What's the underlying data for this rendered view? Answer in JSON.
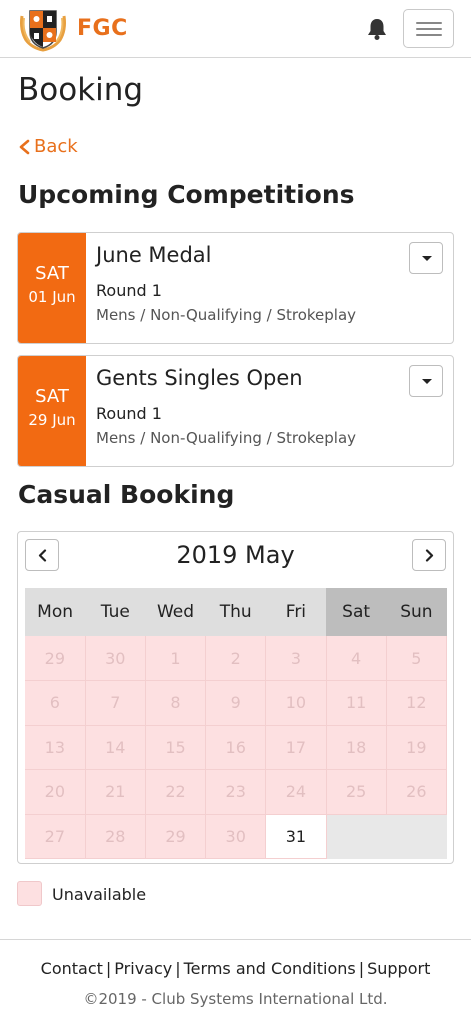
{
  "header": {
    "brand": "FGC",
    "icons": {
      "logo": "club-crest-logo",
      "notifications": "bell-icon",
      "menu": "hamburger-menu-icon"
    },
    "accent_color": "#e8701c"
  },
  "page": {
    "title": "Booking",
    "back_label": "Back"
  },
  "upcoming": {
    "title": "Upcoming Competitions",
    "items": [
      {
        "day": "SAT",
        "date": "01 Jun",
        "name": "June Medal",
        "round": "Round 1",
        "type": "Mens / Non-Qualifying / Strokeplay"
      },
      {
        "day": "SAT",
        "date": "29 Jun",
        "name": "Gents Singles Open",
        "round": "Round 1",
        "type": "Mens / Non-Qualifying / Strokeplay"
      }
    ]
  },
  "casual": {
    "title": "Casual Booking",
    "calendar": {
      "title": "2019 May",
      "weekdays": [
        "Mon",
        "Tue",
        "Wed",
        "Thu",
        "Fri",
        "Sat",
        "Sun"
      ],
      "weeks": [
        [
          {
            "d": "29",
            "s": "unavailable"
          },
          {
            "d": "30",
            "s": "unavailable"
          },
          {
            "d": "1",
            "s": "unavailable"
          },
          {
            "d": "2",
            "s": "unavailable"
          },
          {
            "d": "3",
            "s": "unavailable"
          },
          {
            "d": "4",
            "s": "unavailable"
          },
          {
            "d": "5",
            "s": "unavailable"
          }
        ],
        [
          {
            "d": "6",
            "s": "unavailable"
          },
          {
            "d": "7",
            "s": "unavailable"
          },
          {
            "d": "8",
            "s": "unavailable"
          },
          {
            "d": "9",
            "s": "unavailable"
          },
          {
            "d": "10",
            "s": "unavailable"
          },
          {
            "d": "11",
            "s": "unavailable"
          },
          {
            "d": "12",
            "s": "unavailable"
          }
        ],
        [
          {
            "d": "13",
            "s": "unavailable"
          },
          {
            "d": "14",
            "s": "unavailable"
          },
          {
            "d": "15",
            "s": "unavailable"
          },
          {
            "d": "16",
            "s": "unavailable"
          },
          {
            "d": "17",
            "s": "unavailable"
          },
          {
            "d": "18",
            "s": "unavailable"
          },
          {
            "d": "19",
            "s": "unavailable"
          }
        ],
        [
          {
            "d": "20",
            "s": "unavailable"
          },
          {
            "d": "21",
            "s": "unavailable"
          },
          {
            "d": "22",
            "s": "unavailable"
          },
          {
            "d": "23",
            "s": "unavailable"
          },
          {
            "d": "24",
            "s": "unavailable"
          },
          {
            "d": "25",
            "s": "unavailable"
          },
          {
            "d": "26",
            "s": "unavailable"
          }
        ],
        [
          {
            "d": "27",
            "s": "unavailable"
          },
          {
            "d": "28",
            "s": "unavailable"
          },
          {
            "d": "29",
            "s": "unavailable"
          },
          {
            "d": "30",
            "s": "unavailable"
          },
          {
            "d": "31",
            "s": "available"
          },
          {
            "d": "",
            "s": "empty"
          },
          {
            "d": "",
            "s": "empty"
          }
        ]
      ]
    },
    "legend": {
      "unavailable_label": "Unavailable",
      "unavailable_color": "#fde0e1"
    }
  },
  "footer": {
    "links": [
      "Contact",
      "Privacy",
      "Terms and Conditions",
      "Support"
    ],
    "copyright": "©2019 - Club Systems International Ltd."
  }
}
